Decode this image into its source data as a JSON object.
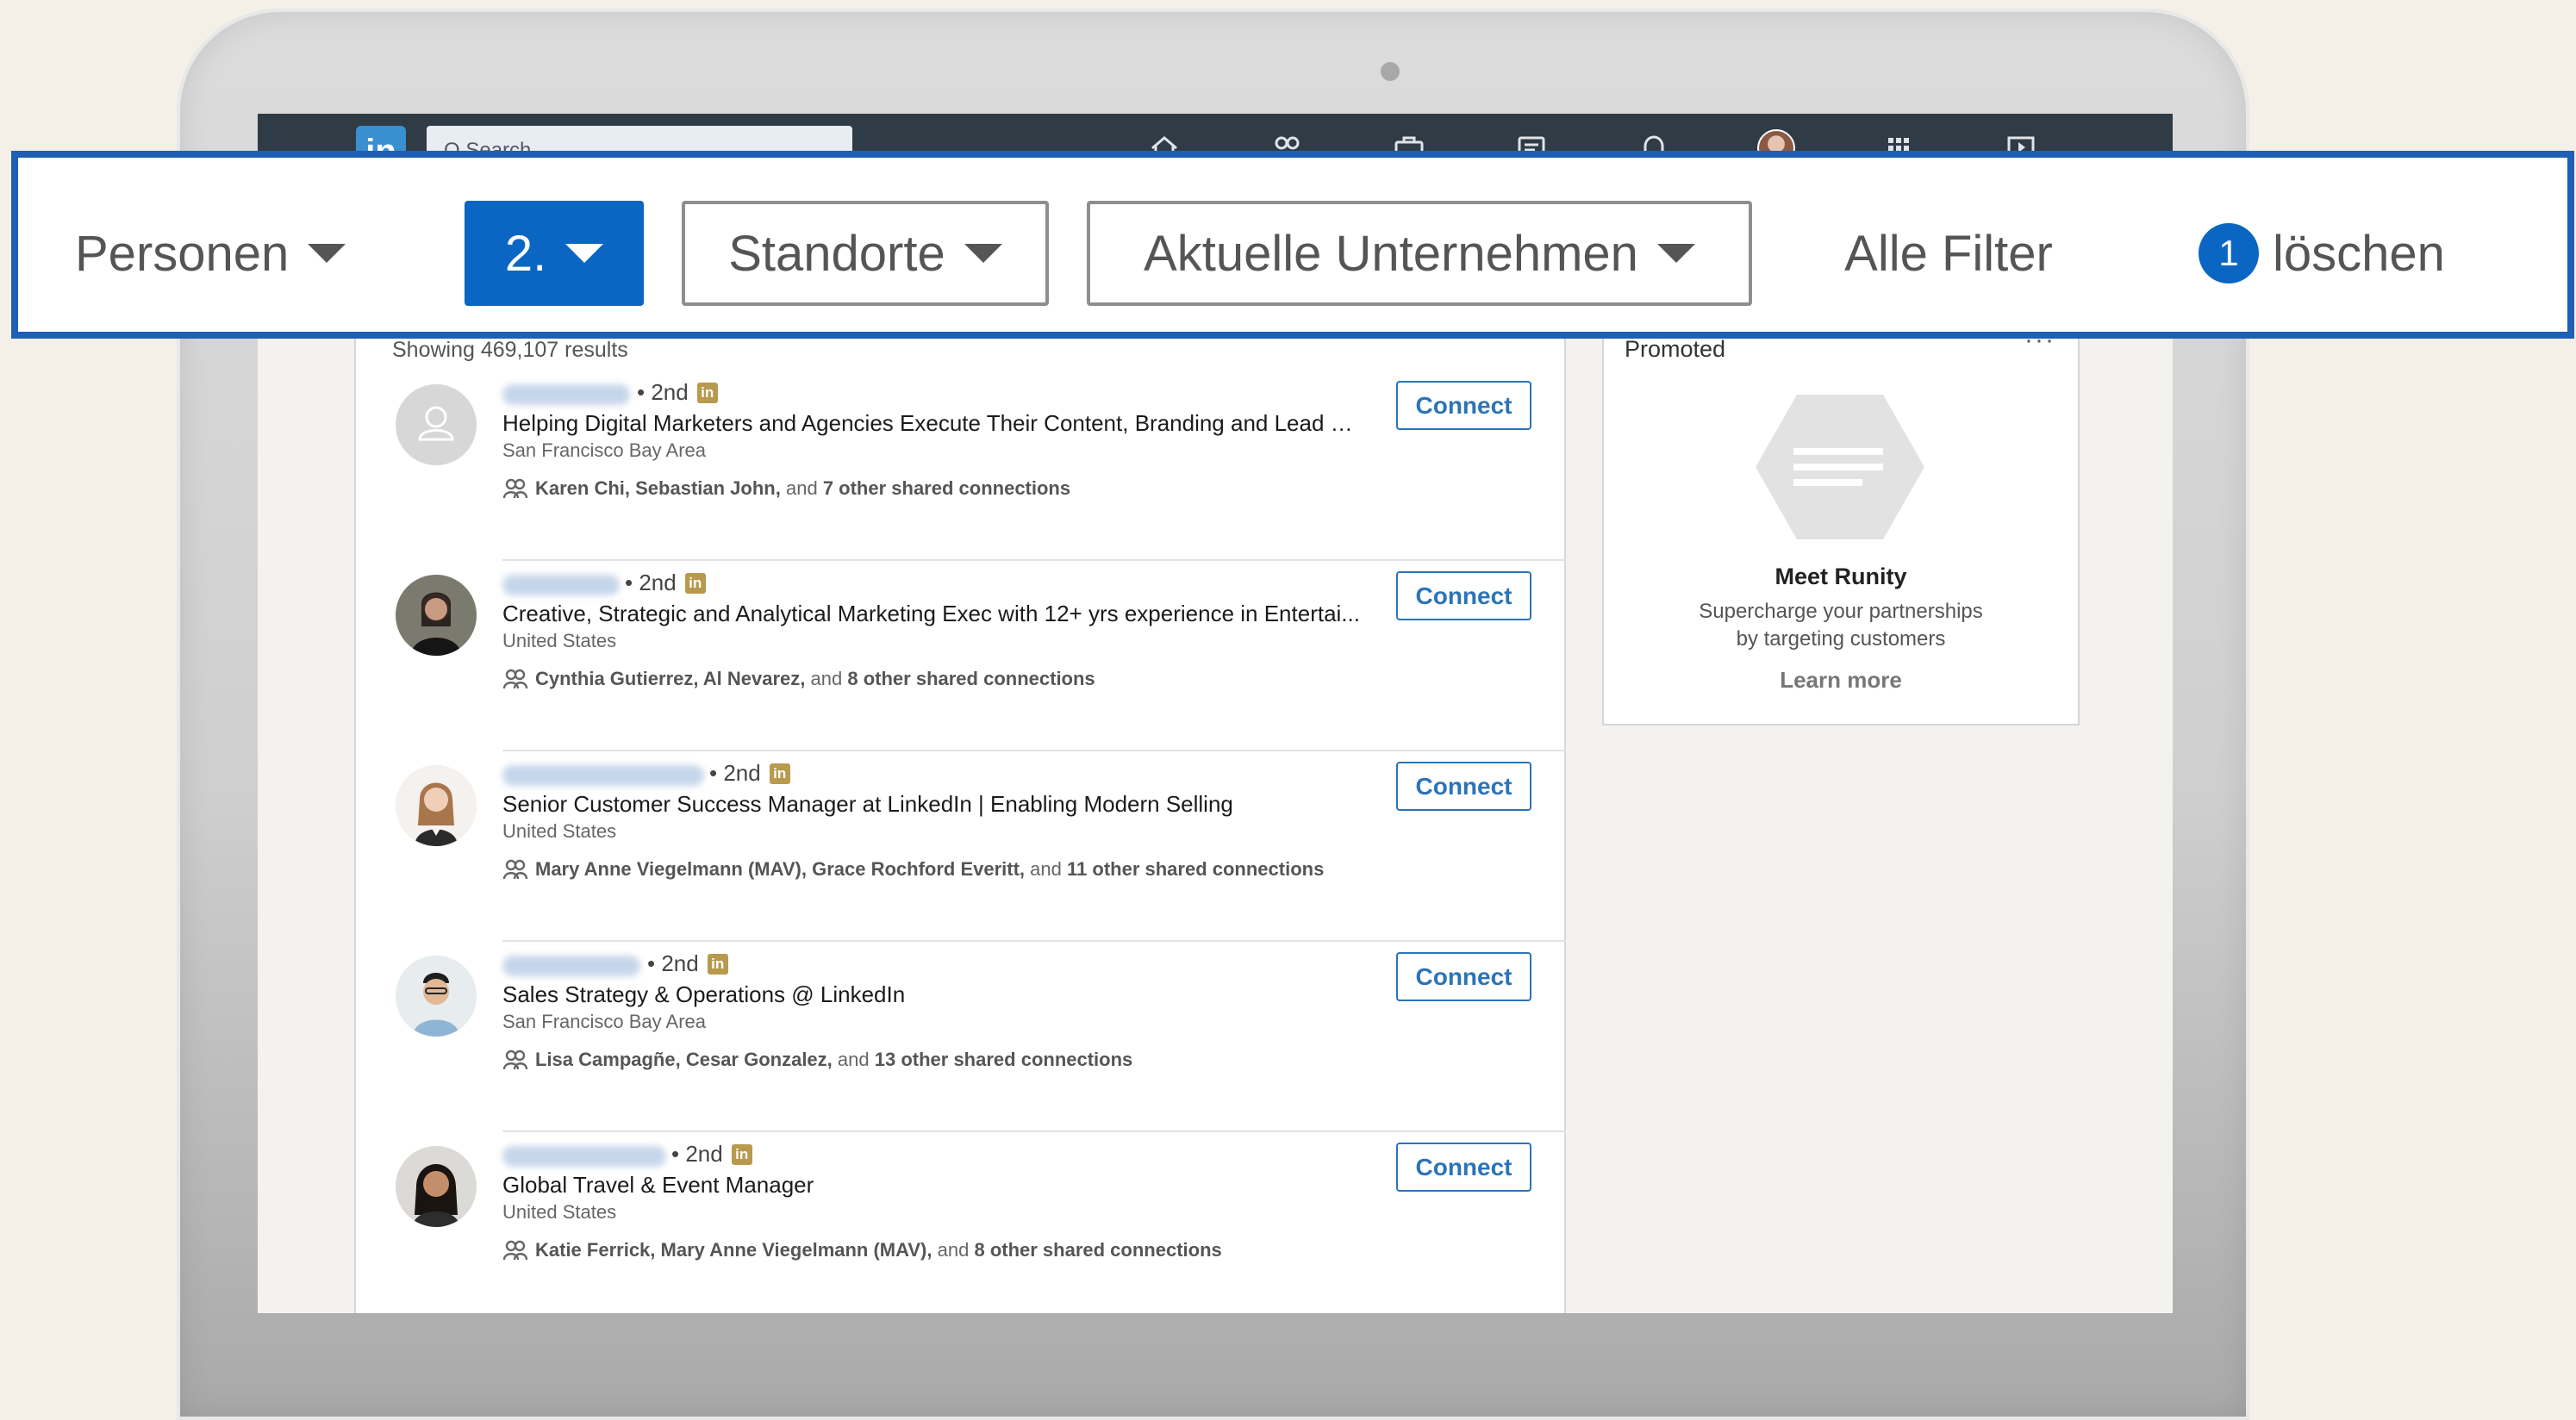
{
  "nav": {
    "logo": "in",
    "search_placeholder": "Q Search"
  },
  "filters": {
    "people": "Personen",
    "connections": "2.",
    "locations": "Standorte",
    "current_companies": "Aktuelle Unternehmen",
    "all_filters": "Alle Filter",
    "clear_count": "1",
    "clear_label": "löschen"
  },
  "results": {
    "count_text": "Showing 469,107 results",
    "connect_label": "Connect",
    "items": [
      {
        "degree": "• 2nd",
        "headline": "Helping Digital Marketers and Agencies Execute Their Content, Branding and Lead G...",
        "location": "San Francisco Bay Area",
        "shared_names": "Karen Chi, Sebastian John,",
        "shared_and": "and",
        "shared_count": "7 other shared connections"
      },
      {
        "degree": "• 2nd",
        "headline": "Creative, Strategic and Analytical Marketing Exec with 12+ yrs experience in Entertai...",
        "location": "United States",
        "shared_names": "Cynthia Gutierrez, Al Nevarez,",
        "shared_and": "and",
        "shared_count": "8 other shared connections"
      },
      {
        "degree": "• 2nd",
        "headline": "Senior Customer Success Manager at LinkedIn | Enabling Modern Selling",
        "location": "United States",
        "shared_names": "Mary Anne Viegelmann (MAV), Grace Rochford Everitt,",
        "shared_and": "and",
        "shared_count": "11 other shared connections"
      },
      {
        "degree": "• 2nd",
        "headline": "Sales Strategy & Operations @ LinkedIn",
        "location": "San Francisco Bay Area",
        "shared_names": "Lisa Campagñe, Cesar Gonzalez,",
        "shared_and": "and",
        "shared_count": "13 other shared connections"
      },
      {
        "degree": "• 2nd",
        "headline": "Global Travel & Event Manager",
        "location": "United States",
        "shared_names": "Katie Ferrick, Mary Anne Viegelmann (MAV),",
        "shared_and": "and",
        "shared_count": "8 other shared connections"
      }
    ]
  },
  "promo": {
    "label": "Promoted",
    "more": "···",
    "title": "Meet Runity",
    "desc_line1": "Supercharge your partnerships",
    "desc_line2": "by targeting customers",
    "link": "Learn more"
  },
  "colors": {
    "brand_blue": "#0a66c2",
    "highlight_border": "#1f5fb5",
    "connect_blue": "#2b74b8",
    "nav_bg": "#2f3b45"
  },
  "icons": [
    "home-icon",
    "my-network-icon",
    "jobs-icon",
    "messaging-icon",
    "notifications-icon",
    "apps-grid-icon",
    "video-icon",
    "people-icon",
    "linkedin-badge-icon",
    "profile-placeholder-icon"
  ]
}
